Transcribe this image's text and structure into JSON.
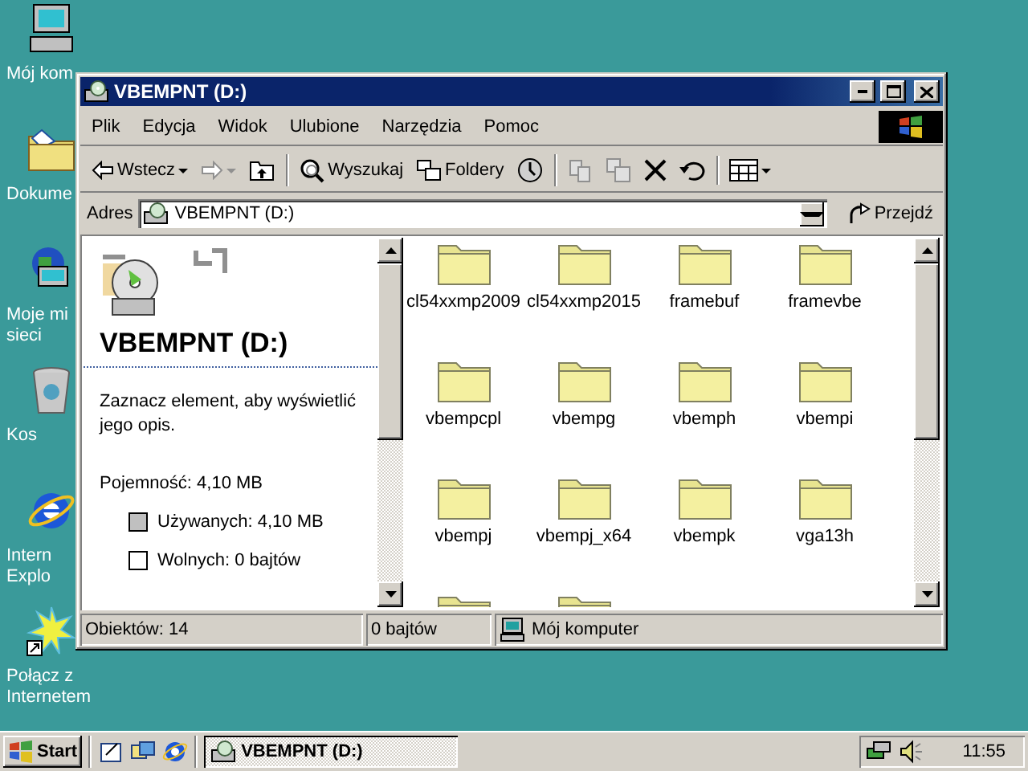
{
  "desktop_icons": [
    {
      "lines": [
        "Mój kom"
      ]
    },
    {
      "lines": [
        "Dokume"
      ]
    },
    {
      "lines": [
        "Moje mi",
        "sieci"
      ]
    },
    {
      "lines": [
        "Kos"
      ]
    },
    {
      "lines": [
        "Intern",
        "Explo"
      ]
    },
    {
      "lines": [
        "Połącz z",
        "Internetem"
      ]
    }
  ],
  "window": {
    "title": "VBEMPNT (D:)",
    "menu": [
      "Plik",
      "Edycja",
      "Widok",
      "Ulubione",
      "Narzędzia",
      "Pomoc"
    ],
    "toolbar": [
      [
        {
          "label": "Wstecz",
          "menu": true,
          "disabled": false
        },
        {
          "menu": true,
          "disabled": true
        },
        {
          "disabled": false
        }
      ],
      [
        {
          "label": "Wyszukaj",
          "disabled": false
        },
        {
          "label": "Foldery",
          "disabled": false
        },
        {
          "disabled": false
        }
      ],
      [
        {
          "disabled": true
        },
        {
          "disabled": true
        },
        {
          "disabled": false
        },
        {
          "disabled": false
        }
      ],
      [
        {
          "menu": true,
          "disabled": false
        }
      ]
    ],
    "address": {
      "label": "Adres",
      "value": "VBEMPNT (D:)",
      "go": "Przejdź"
    },
    "info_panel": {
      "title": "VBEMPNT (D:)",
      "description": "Zaznacz element, aby wyświetlić jego opis.",
      "capacity": "Pojemność: 4,10 MB",
      "legend": [
        {
          "label": "Używanych: 4,10 MB",
          "color": "#c0c0c0"
        },
        {
          "label": "Wolnych: 0 bajtów",
          "color": "#ffffff"
        }
      ]
    },
    "files": [
      {
        "kind": "folder",
        "name": "cl54xxmp2009"
      },
      {
        "kind": "folder",
        "name": "cl54xxmp2015"
      },
      {
        "kind": "folder",
        "name": "framebuf"
      },
      {
        "kind": "folder",
        "name": "framevbe"
      },
      {
        "kind": "folder",
        "name": "vbempcpl"
      },
      {
        "kind": "folder",
        "name": "vbempg"
      },
      {
        "kind": "folder",
        "name": "vbemph"
      },
      {
        "kind": "folder",
        "name": "vbempi"
      },
      {
        "kind": "folder",
        "name": "vbempj"
      },
      {
        "kind": "folder",
        "name": "vbempj_x64"
      },
      {
        "kind": "folder",
        "name": "vbempk"
      },
      {
        "kind": "folder",
        "name": "vga13h"
      },
      {
        "kind": "folder"
      },
      {
        "kind": "folder"
      }
    ],
    "status_bar": [
      "Obiektów: 14",
      "0 bajtów",
      "Mój komputer"
    ]
  },
  "taskbar": {
    "start": "Start",
    "tasks": [
      {
        "title": "VBEMPNT (D:)",
        "selected": true
      }
    ],
    "clock": "11:55"
  }
}
